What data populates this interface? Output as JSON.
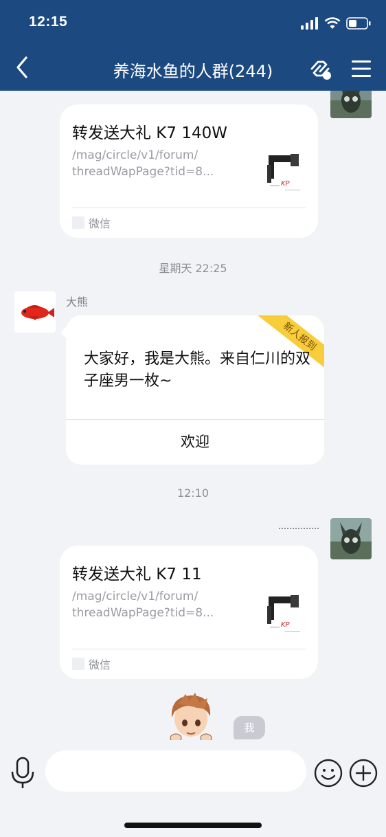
{
  "status_bar": {
    "time": "12:15"
  },
  "header": {
    "title": "养海水鱼的人群(244)"
  },
  "messages": [
    {
      "type": "link_card",
      "title": "转发送大礼 K7 140W",
      "desc_line1": "/mag/circle/v1/forum/",
      "desc_line2": "threadWapPage?tid=8...",
      "source": "微信"
    },
    {
      "type": "time",
      "text": "星期天 22:25"
    },
    {
      "type": "welcome_card",
      "sender": "大熊",
      "ribbon": "新人报到",
      "text": "大家好，我是大熊。来自仁川的双子座男一枚~",
      "button_label": "欢迎"
    },
    {
      "type": "time",
      "text": "12:10"
    },
    {
      "type": "link_card",
      "title": "转发送大礼 K7 11",
      "desc_line1": "/mag/circle/v1/forum/",
      "desc_line2": "threadWapPage?tid=8...",
      "source": "微信"
    }
  ],
  "me_tag": "我",
  "input": {
    "placeholder": ""
  },
  "colors": {
    "header_bg": "#1c4a80",
    "ribbon": "#f7cd3a",
    "background": "#f2f3f7"
  }
}
